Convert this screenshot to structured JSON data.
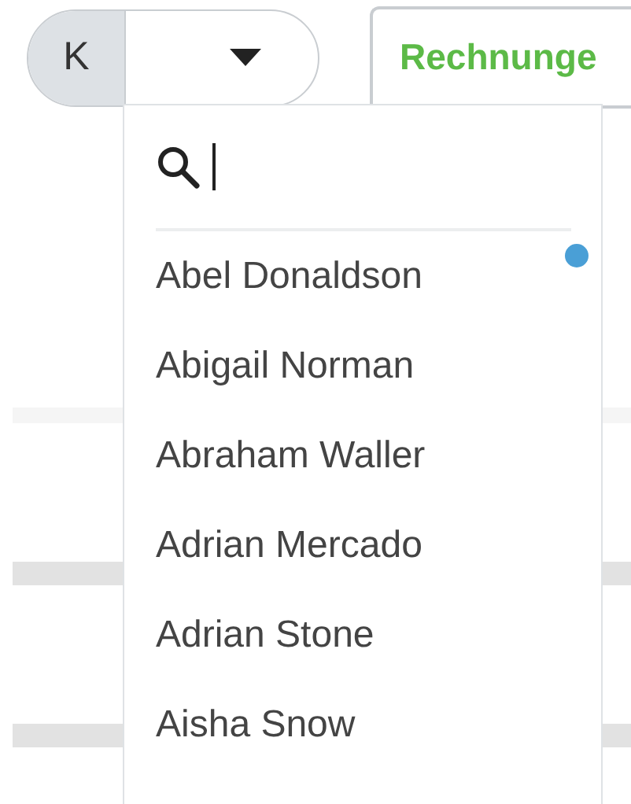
{
  "account_switch": {
    "initial": "K",
    "expanded": true
  },
  "tab": {
    "label": "Rechnunge"
  },
  "dropdown": {
    "items": [
      {
        "name": "Abel Donaldson",
        "marked": true
      },
      {
        "name": "Abigail Norman",
        "marked": false
      },
      {
        "name": "Abraham Waller",
        "marked": false
      },
      {
        "name": "Adrian Mercado",
        "marked": false
      },
      {
        "name": "Adrian Stone",
        "marked": false
      },
      {
        "name": "Aisha Snow",
        "marked": false
      }
    ]
  }
}
